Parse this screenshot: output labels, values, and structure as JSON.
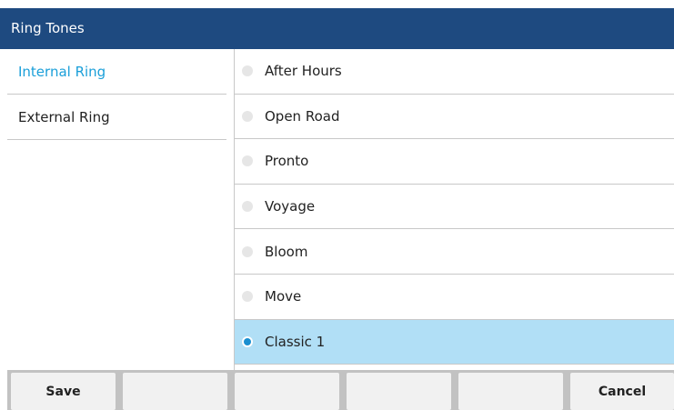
{
  "title": "Ring Tones",
  "sidebar": {
    "items": [
      {
        "label": "Internal Ring",
        "active": true
      },
      {
        "label": "External Ring",
        "active": false
      }
    ]
  },
  "options": [
    {
      "label": "After Hours",
      "selected": false
    },
    {
      "label": "Open Road",
      "selected": false
    },
    {
      "label": "Pronto",
      "selected": false
    },
    {
      "label": "Voyage",
      "selected": false
    },
    {
      "label": "Bloom",
      "selected": false
    },
    {
      "label": "Move",
      "selected": false
    },
    {
      "label": "Classic 1",
      "selected": true
    }
  ],
  "softkeys": [
    "Save",
    "",
    "",
    "",
    "",
    "Cancel"
  ],
  "colors": {
    "titlebar": "#1e4a80",
    "accent": "#1a9fd9",
    "selected_row": "#b1dff6"
  }
}
